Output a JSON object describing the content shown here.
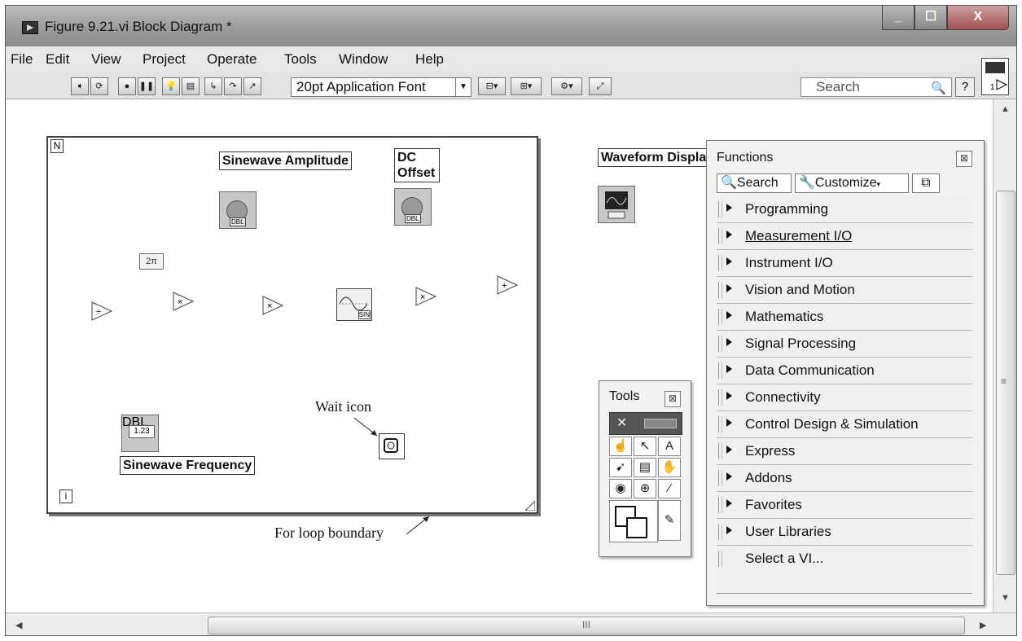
{
  "window": {
    "title": "Figure 9.21.vi Block Diagram *"
  },
  "menu": [
    "File",
    "Edit",
    "View",
    "Project",
    "Operate",
    "Tools",
    "Window",
    "Help"
  ],
  "toolbar": {
    "font": "20pt Application Font",
    "search_placeholder": "Search",
    "help": "?"
  },
  "diagram": {
    "loop_count": "N",
    "loop_index": "i",
    "const_2pi": "2π",
    "sinewave_amplitude": "Sinewave Amplitude",
    "dc_offset": "DC Offset",
    "sinewave_frequency": "Sinewave Frequency",
    "waveform_display": "Waveform Display",
    "annotation_wait": "Wait icon",
    "annotation_loop": "For loop boundary",
    "num_ctrl_value": "1.23",
    "type_tag": "DBL",
    "sin_tag": "SIN"
  },
  "tools_palette": {
    "title": "Tools"
  },
  "functions_palette": {
    "title": "Functions",
    "search_btn": "Search",
    "customize_btn": "Customize",
    "items": [
      "Programming",
      "Measurement I/O",
      "Instrument I/O",
      "Vision and Motion",
      "Mathematics",
      "Signal Processing",
      "Data Communication",
      "Connectivity",
      "Control Design & Simulation",
      "Express",
      "Addons",
      "Favorites",
      "User Libraries"
    ],
    "last_item": "Select a VI..."
  }
}
